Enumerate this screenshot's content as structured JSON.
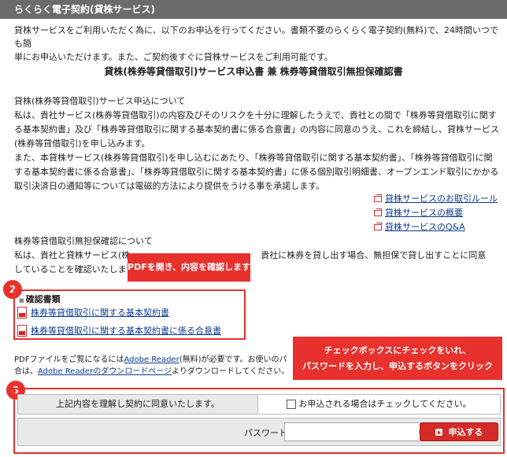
{
  "header": {
    "title": "らくらく電子契約(貸株サービス)"
  },
  "intro": {
    "line1": "貸株サービスをご利用いただく為に、以下のお申込を行ってください。書類不要のらくらく電子契約(無料)で、24時間いつでも簡",
    "line2": "単にお申込いただけます。また、ご契約後すぐに貸株サービスをご利用可能です。"
  },
  "doc_title": "貸株(株券等貸借取引)サービス申込書 兼 株券等貸借取引無担保確認書",
  "section1": {
    "heading": "貸株(株券等貸借取引)サービス申込について",
    "lines": [
      "私は、貴社サービス(株券等貸借取引)の内容及びそのリスクを十分に理解したうえで、貴社との間で「株券等貸借取引に関す",
      "る基本契約書」及び「株券等貸借取引に関する基本契約書に係る合意書」の内容に同意のうえ、これを締結し、貸株サービス",
      "(株券等貸借取引)を申し込みます。",
      "また、本貸株サービス(株券等貸借取引)を申し込むにあたり、「株券等貸借取引に関する基本契約書」、「株券等貸借取引に関",
      "する基本契約書に係る合意書」、「株券等貸借取引に関する基本契約書」に係る個別取引明細書、オープンエンド取引にかかる",
      "取引決済日の通知等については電磁的方法により提供をうける事を承諾します。"
    ]
  },
  "links": [
    {
      "label": "貸株サービスのお取引ルール"
    },
    {
      "label": "貸株サービスの概要"
    },
    {
      "label": "貸株サービスのQ&A"
    }
  ],
  "section2": {
    "heading": "株券等貸借取引無担保確認について",
    "line1_a": "私は、貴社と貸株サービス(株",
    "line1_b": "貴社に株券を貸し出す場合、無担保で貸し出すことに同意",
    "line2": "していることを確認いたしま"
  },
  "callouts": {
    "step1": "PDFを開き、内容を確認します",
    "step2_line1": "チェックボックスにチェックをいれ、",
    "step2_line2": "パスワードを入力し、申込するボタンをクリック"
  },
  "badges": {
    "two": "2",
    "three": "3"
  },
  "confirm": {
    "title": "確認書類",
    "docs": [
      {
        "label": "株券等貸借取引に関する基本契約書"
      },
      {
        "label": "株券等貸借取引に関する基本契約書に係る合意書"
      }
    ]
  },
  "note": {
    "l1_a": "PDFファイルをご覧になるには",
    "l1_link": "Adobe Reader",
    "l1_b": "(無料)が必要です。お使いのパ",
    "l2_a": "合は、",
    "l2_link": "Adobe Readerのダウンロードページ",
    "l2_b": "よりダウンロードしてください。"
  },
  "form": {
    "agree_text": "上記内容を理解し契約に同意いたします。",
    "checkbox_label": "お申込される場合はチェックしてください。",
    "password_label": "パスワード",
    "password_value": "",
    "submit_label": "申込する"
  },
  "colors": {
    "accent": "#e8312d",
    "header_bg": "#6b6b6b",
    "link": "#0b3d91"
  }
}
